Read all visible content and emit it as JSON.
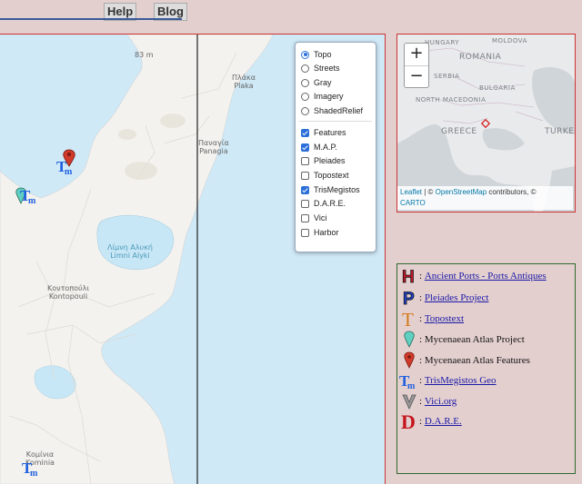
{
  "nav": {
    "help": "Help",
    "blog": "Blog"
  },
  "map": {
    "scale_label": "83 m",
    "places": [
      {
        "name": "Πλάκα\nPlaka"
      },
      {
        "name": "Παναγία\nPanagia"
      },
      {
        "name": "Λίμνη Αλυκή\nLimni Alyki"
      },
      {
        "name": "Κοντοπούλι\nKontopouli"
      },
      {
        "name": "Κομίνια\nKominia"
      }
    ]
  },
  "layers": {
    "base": [
      {
        "label": "Topo",
        "selected": true
      },
      {
        "label": "Streets",
        "selected": false
      },
      {
        "label": "Gray",
        "selected": false
      },
      {
        "label": "Imagery",
        "selected": false
      },
      {
        "label": "ShadedRelief",
        "selected": false
      }
    ],
    "overlays": [
      {
        "label": "Features",
        "checked": true
      },
      {
        "label": "M.A.P.",
        "checked": true
      },
      {
        "label": "Pleiades",
        "checked": false
      },
      {
        "label": "Topostext",
        "checked": false
      },
      {
        "label": "TrisMegistos",
        "checked": true
      },
      {
        "label": "D.A.R.E.",
        "checked": false
      },
      {
        "label": "Vici",
        "checked": false
      },
      {
        "label": "Harbor",
        "checked": false
      }
    ]
  },
  "minimap": {
    "zoom_in": "+",
    "zoom_out": "−",
    "countries": [
      "HUNGARY",
      "MOLDOVA",
      "ROMANIA",
      "SERBIA",
      "BULGARIA",
      "NORTH MACEDONIA",
      "GREECE",
      "TURKE"
    ],
    "attribution": {
      "leaflet": "Leaflet",
      "sep": " | © ",
      "osm": "OpenStreetMap",
      "rest": " contributors, © ",
      "carto": "CARTO"
    }
  },
  "legend": {
    "items": [
      {
        "icon": "harbor-icon",
        "text": "Ancient Ports - Ports Antiques",
        "link": true,
        "color": "#c0182a"
      },
      {
        "icon": "pleiades-icon",
        "text": "Pleiades Project",
        "link": true,
        "color": "#2244cc"
      },
      {
        "icon": "topostext-icon",
        "text": "Topostext",
        "link": true,
        "color": "#d47a1a"
      },
      {
        "icon": "map-pin-teal-icon",
        "text": "Mycenaean Atlas Project",
        "link": false,
        "color": "#5fd0c0"
      },
      {
        "icon": "map-pin-red-icon",
        "text": "Mycenaean Atlas Features",
        "link": false,
        "color": "#d03a2a"
      },
      {
        "icon": "trismegistos-icon",
        "text": "TrisMegistos Geo",
        "link": true,
        "color": "#1f5fe0"
      },
      {
        "icon": "vici-icon",
        "text": "Vici.org",
        "link": true,
        "color": "#888888"
      },
      {
        "icon": "dare-icon",
        "text": "D.A.R.E.",
        "link": true,
        "color": "#c4161c"
      }
    ]
  }
}
